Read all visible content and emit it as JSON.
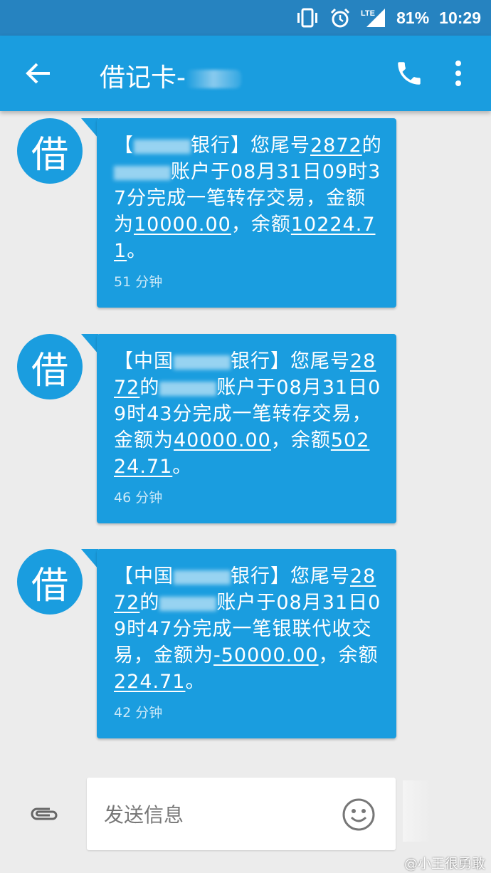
{
  "status_bar": {
    "network": "LTE",
    "battery": "81%",
    "time": "10:29",
    "icons": [
      "vibrate-icon",
      "alarm-icon",
      "lte-signal-icon"
    ]
  },
  "app_bar": {
    "title": "借记卡-",
    "icons": [
      "back-arrow-icon",
      "phone-call-icon",
      "more-vert-icon"
    ]
  },
  "messages": [
    {
      "avatar": "借",
      "parts": [
        {
          "t": "【"
        },
        {
          "t": "",
          "redacted": true
        },
        {
          "t": "银行】您尾号"
        },
        {
          "t": "2872",
          "u": true
        },
        {
          "t": "的"
        },
        {
          "t": "",
          "redacted": true
        },
        {
          "t": "账户于08月31日09时37分完成一笔转存交易，金额为"
        },
        {
          "t": "10000.00",
          "u": true
        },
        {
          "t": "，余额"
        },
        {
          "t": "10224.71",
          "u": true
        },
        {
          "t": "。"
        }
      ],
      "time": "51 分钟"
    },
    {
      "avatar": "借",
      "parts": [
        {
          "t": "【中国"
        },
        {
          "t": "",
          "redacted": true
        },
        {
          "t": "银行】您尾号"
        },
        {
          "t": "2872",
          "u": true
        },
        {
          "t": "的"
        },
        {
          "t": "",
          "redacted": true
        },
        {
          "t": "账户于08月31日09时43分完成一笔转存交易，金额为"
        },
        {
          "t": "40000.00",
          "u": true
        },
        {
          "t": "，余额"
        },
        {
          "t": "50224.71",
          "u": true
        },
        {
          "t": "。"
        }
      ],
      "time": "46 分钟"
    },
    {
      "avatar": "借",
      "parts": [
        {
          "t": "【中国"
        },
        {
          "t": "",
          "redacted": true
        },
        {
          "t": "银行】您尾号"
        },
        {
          "t": "2872",
          "u": true
        },
        {
          "t": "的"
        },
        {
          "t": "",
          "redacted": true
        },
        {
          "t": "账户于08月31日09时47分完成一笔银联代收交易，金额为"
        },
        {
          "t": "-50000.00",
          "u": true
        },
        {
          "t": "，余额"
        },
        {
          "t": "224.71",
          "u": true
        },
        {
          "t": "。"
        }
      ],
      "time": "42 分钟"
    }
  ],
  "compose": {
    "placeholder": "发送信息",
    "icons": [
      "attach-icon",
      "emoji-icon"
    ]
  },
  "watermark": "@小王很勇敢",
  "colors": {
    "status_bar": "#2683c0",
    "app_bar": "#1a9ddf",
    "bubble": "#1a9ddf",
    "background": "#ececec"
  }
}
